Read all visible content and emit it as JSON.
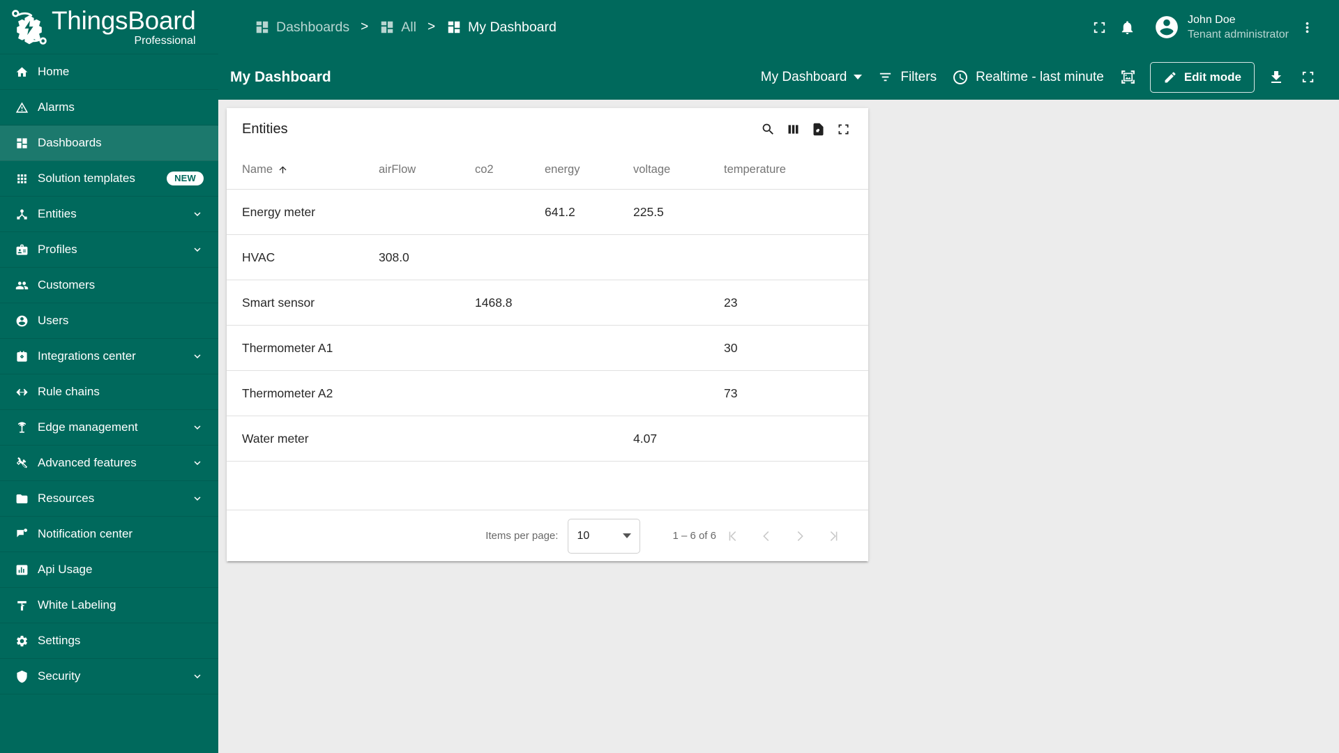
{
  "brand": {
    "name": "ThingsBoard",
    "edition": "Professional",
    "logo_icon": "thingsboard-logo-icon"
  },
  "colors": {
    "primary": "#00695c",
    "active_item": "#1a786d",
    "background": "#ececec",
    "card": "#ffffff"
  },
  "sidebar": {
    "items": [
      {
        "label": "Home",
        "icon": "home-icon",
        "expandable": false,
        "active": false
      },
      {
        "label": "Alarms",
        "icon": "alarm-warning-icon",
        "expandable": false,
        "active": false
      },
      {
        "label": "Dashboards",
        "icon": "dashboards-icon",
        "expandable": false,
        "active": true
      },
      {
        "label": "Solution templates",
        "icon": "apps-grid-icon",
        "expandable": false,
        "active": false,
        "badge": "NEW"
      },
      {
        "label": "Entities",
        "icon": "entities-hub-icon",
        "expandable": true,
        "active": false
      },
      {
        "label": "Profiles",
        "icon": "badge-icon",
        "expandable": true,
        "active": false
      },
      {
        "label": "Customers",
        "icon": "people-icon",
        "expandable": false,
        "active": false
      },
      {
        "label": "Users",
        "icon": "account-circle-icon",
        "expandable": false,
        "active": false
      },
      {
        "label": "Integrations center",
        "icon": "integrations-icon",
        "expandable": true,
        "active": false
      },
      {
        "label": "Rule chains",
        "icon": "rule-chains-icon",
        "expandable": false,
        "active": false
      },
      {
        "label": "Edge management",
        "icon": "edge-antenna-icon",
        "expandable": true,
        "active": false
      },
      {
        "label": "Advanced features",
        "icon": "tools-icon",
        "expandable": true,
        "active": false
      },
      {
        "label": "Resources",
        "icon": "folder-icon",
        "expandable": true,
        "active": false
      },
      {
        "label": "Notification center",
        "icon": "notification-flag-icon",
        "expandable": false,
        "active": false
      },
      {
        "label": "Api Usage",
        "icon": "api-usage-chart-icon",
        "expandable": false,
        "active": false
      },
      {
        "label": "White Labeling",
        "icon": "paint-roller-icon",
        "expandable": false,
        "active": false
      },
      {
        "label": "Settings",
        "icon": "gear-icon",
        "expandable": false,
        "active": false
      },
      {
        "label": "Security",
        "icon": "shield-icon",
        "expandable": true,
        "active": false
      }
    ]
  },
  "header": {
    "breadcrumb": [
      {
        "label": "Dashboards",
        "icon": "dashboards-icon"
      },
      {
        "label": "All",
        "icon": "dashboards-icon"
      },
      {
        "label": "My Dashboard",
        "icon": "dashboards-icon"
      }
    ],
    "separator": ">",
    "icons": [
      "fullscreen-icon",
      "bell-icon",
      "more-vert-icon"
    ],
    "user": {
      "name": "John Doe",
      "role": "Tenant administrator",
      "avatar_icon": "account-circle-icon"
    }
  },
  "toolbar": {
    "title": "My Dashboard",
    "dashboard_select": "My Dashboard",
    "filters_label": "Filters",
    "timewindow_label": "Realtime - last minute",
    "edit_mode_label": "Edit mode",
    "icons": [
      "filter-icon",
      "clock-icon",
      "image-export-icon",
      "pencil-icon",
      "download-icon",
      "fullscreen-icon"
    ]
  },
  "widget": {
    "title": "Entities",
    "actions": [
      "search-icon",
      "columns-icon",
      "file-export-icon",
      "fullscreen-icon"
    ],
    "table": {
      "sort_column": "Name",
      "sort_direction": "ascending",
      "columns": [
        "Name",
        "airFlow",
        "co2",
        "energy",
        "voltage",
        "temperature"
      ],
      "rows": [
        {
          "name": "Energy meter",
          "airFlow": "",
          "co2": "",
          "energy": "641.2",
          "voltage": "225.5",
          "temperature": ""
        },
        {
          "name": "HVAC",
          "airFlow": "308.0",
          "co2": "",
          "energy": "",
          "voltage": "",
          "temperature": ""
        },
        {
          "name": "Smart sensor",
          "airFlow": "",
          "co2": "1468.8",
          "energy": "",
          "voltage": "",
          "temperature": "23"
        },
        {
          "name": "Thermometer A1",
          "airFlow": "",
          "co2": "",
          "energy": "",
          "voltage": "",
          "temperature": "30"
        },
        {
          "name": "Thermometer A2",
          "airFlow": "",
          "co2": "",
          "energy": "",
          "voltage": "",
          "temperature": "73"
        },
        {
          "name": "Water meter",
          "airFlow": "",
          "co2": "",
          "energy": "",
          "voltage": "4.07",
          "temperature": ""
        }
      ]
    },
    "paginator": {
      "items_per_page_label": "Items per page:",
      "page_size": "10",
      "range_label": "1 – 6 of 6",
      "buttons": [
        "first-page-icon",
        "previous-page-icon",
        "next-page-icon",
        "last-page-icon"
      ]
    }
  }
}
